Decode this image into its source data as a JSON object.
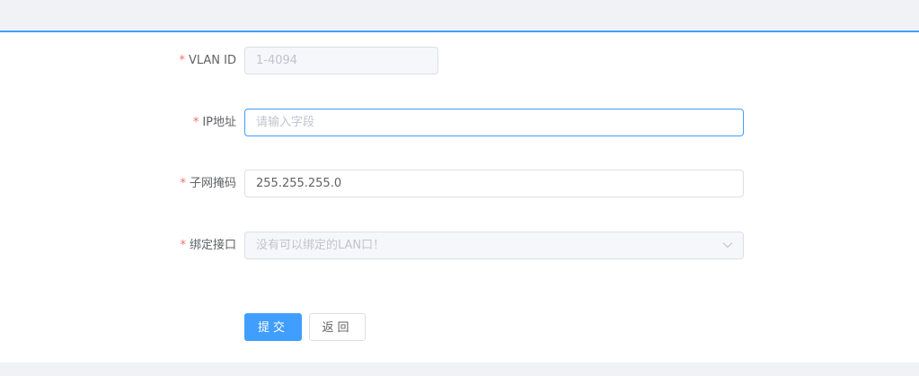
{
  "form": {
    "vlan": {
      "required_mark": "*",
      "label": "VLAN ID",
      "value": "",
      "placeholder": "1-4094"
    },
    "ip": {
      "required_mark": "*",
      "label": "IP地址",
      "value": "",
      "placeholder": "请输入字段"
    },
    "mask": {
      "required_mark": "*",
      "label": "子网掩码",
      "value": "255.255.255.0",
      "placeholder": ""
    },
    "iface": {
      "required_mark": "*",
      "label": "绑定接口",
      "value": "",
      "placeholder": "没有可以绑定的LAN口！",
      "icon": "chevron-down-icon"
    }
  },
  "actions": {
    "submit_label": "提交",
    "back_label": "返回"
  },
  "colors": {
    "accent": "#409eff",
    "required": "#f56c6c",
    "page_bg": "#f0f2f5"
  }
}
